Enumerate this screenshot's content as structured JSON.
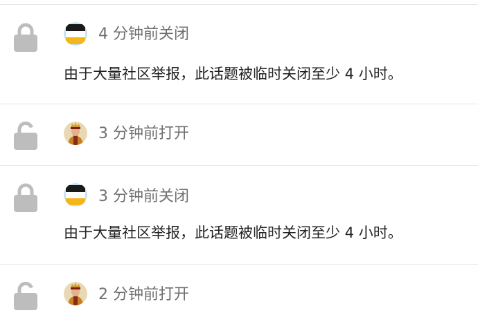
{
  "events": [
    {
      "status_icon": "lock-closed-icon",
      "avatar_icon": "avatar-flag-icon",
      "meta": "4 分钟前关闭",
      "message": "由于大量社区举报，此话题被临时关闭至少 4 小时。"
    },
    {
      "status_icon": "lock-open-icon",
      "avatar_icon": "avatar-portrait-icon",
      "meta": "3 分钟前打开",
      "message": ""
    },
    {
      "status_icon": "lock-closed-icon",
      "avatar_icon": "avatar-flag-icon",
      "meta": "3 分钟前关闭",
      "message": "由于大量社区举报，此话题被临时关闭至少 4 小时。"
    },
    {
      "status_icon": "lock-open-icon",
      "avatar_icon": "avatar-portrait-icon",
      "meta": "2 分钟前打开",
      "message": ""
    }
  ],
  "colors": {
    "icon_gray": "#bdbdbd",
    "meta_text": "#6f6f6f",
    "divider": "#e6e6e6",
    "flag_black": "#1a1a1a",
    "flag_yellow": "#f3b71c",
    "avatar_ring": "#bfe4f6"
  }
}
